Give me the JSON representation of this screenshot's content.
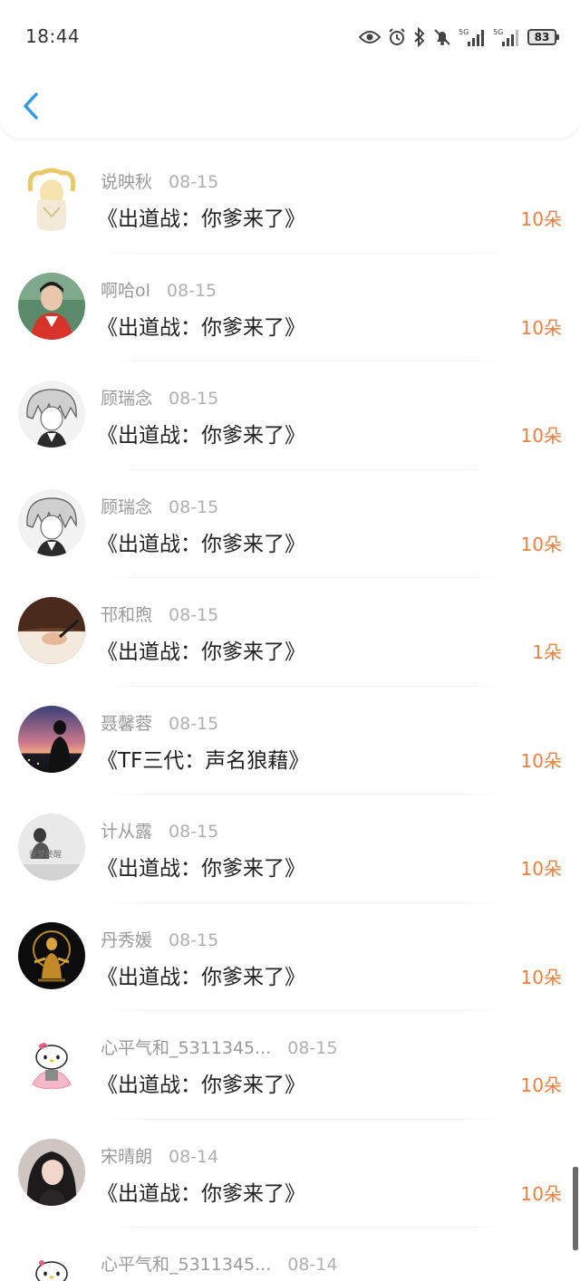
{
  "status_bar": {
    "time": "18:44",
    "battery": "83",
    "icons": [
      "eye-icon",
      "alarm-icon",
      "bluetooth-icon",
      "mute-bell-icon",
      "signal-5g-icon",
      "signal-5g-icon",
      "battery-icon"
    ]
  },
  "nav": {
    "back_icon": "chevron-left-icon"
  },
  "colors": {
    "accent": "#2f9be6",
    "amount": "#ee7f3c",
    "name": "#9a9a9a",
    "title": "#222222"
  },
  "rows": [
    {
      "name": "说映秋",
      "date": "08-15",
      "title": "《出道战：你爹来了》",
      "amount": "10朵"
    },
    {
      "name": "啊哈ol",
      "date": "08-15",
      "title": "《出道战：你爹来了》",
      "amount": "10朵"
    },
    {
      "name": "顾瑞念",
      "date": "08-15",
      "title": "《出道战：你爹来了》",
      "amount": "10朵"
    },
    {
      "name": "顾瑞念",
      "date": "08-15",
      "title": "《出道战：你爹来了》",
      "amount": "10朵"
    },
    {
      "name": "邗和煦",
      "date": "08-15",
      "title": "《出道战：你爹来了》",
      "amount": "1朵"
    },
    {
      "name": "聂馨蓉",
      "date": "08-15",
      "title": "《TF三代：声名狼藉》",
      "amount": "10朵"
    },
    {
      "name": "计从露",
      "date": "08-15",
      "title": "《出道战：你爹来了》",
      "amount": "10朵",
      "avatar_text": "是梦终醒"
    },
    {
      "name": "丹秀媛",
      "date": "08-15",
      "title": "《出道战：你爹来了》",
      "amount": "10朵"
    },
    {
      "name": "心平气和_5311345...",
      "date": "08-15",
      "title": "《出道战：你爹来了》",
      "amount": "10朵"
    },
    {
      "name": "宋晴朗",
      "date": "08-14",
      "title": "《出道战：你爹来了》",
      "amount": "10朵"
    },
    {
      "name": "心平气和_5311345...",
      "date": "08-14",
      "title": "",
      "amount": ""
    }
  ]
}
